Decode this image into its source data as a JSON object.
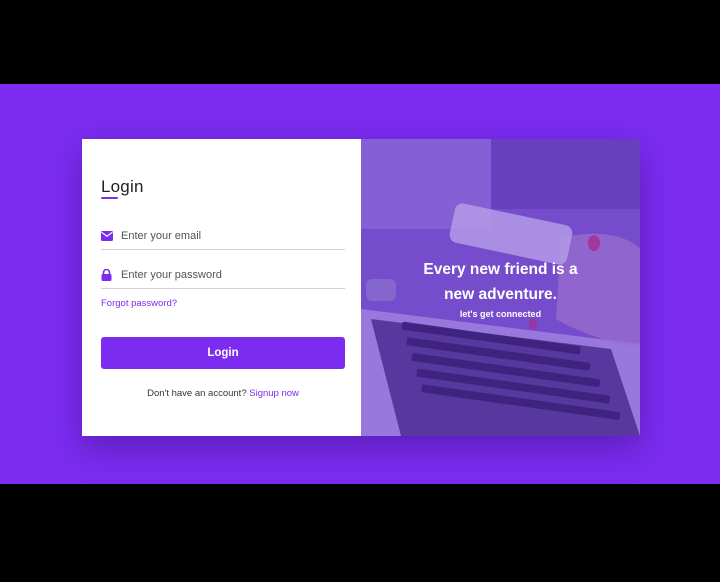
{
  "login_form": {
    "title": "Login",
    "email_placeholder": "Enter your email",
    "password_placeholder": "Enter your password",
    "forgot_password": "Forgot password?",
    "login_button": "Login",
    "signup_prompt": "Don't have an account?",
    "signup_link": "Signup now",
    "email_icon": "envelope-icon",
    "password_icon": "lock-icon"
  },
  "hero": {
    "line1": "Every new friend is a",
    "line2": "new adventure.",
    "subtitle": "let's get connected"
  },
  "colors": {
    "accent": "#7b2cf0",
    "background": "#7b2cf0",
    "card": "#ffffff",
    "letterbox": "#000000"
  }
}
